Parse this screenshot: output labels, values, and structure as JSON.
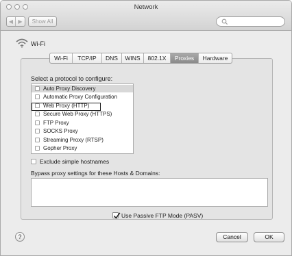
{
  "window": {
    "title": "Network"
  },
  "toolbar": {
    "back_glyph": "◀",
    "forward_glyph": "▶",
    "show_all_label": "Show All",
    "search_value": ""
  },
  "service": {
    "name": "Wi-Fi",
    "icon": "wifi-icon"
  },
  "tabs": [
    {
      "label": "Wi-Fi",
      "active": false
    },
    {
      "label": "TCP/IP",
      "active": false
    },
    {
      "label": "DNS",
      "active": false
    },
    {
      "label": "WINS",
      "active": false
    },
    {
      "label": "802.1X",
      "active": false
    },
    {
      "label": "Proxies",
      "active": true
    },
    {
      "label": "Hardware",
      "active": false
    }
  ],
  "proxies": {
    "protocol_prompt": "Select a protocol to configure:",
    "protocols": [
      {
        "label": "Auto Proxy Discovery",
        "checked": false,
        "selected": true
      },
      {
        "label": "Automatic Proxy Configuration",
        "checked": false,
        "selected": false
      },
      {
        "label": "Web Proxy (HTTP)",
        "checked": false,
        "selected": false,
        "highlighted": true
      },
      {
        "label": "Secure Web Proxy (HTTPS)",
        "checked": false,
        "selected": false
      },
      {
        "label": "FTP Proxy",
        "checked": false,
        "selected": false
      },
      {
        "label": "SOCKS Proxy",
        "checked": false,
        "selected": false
      },
      {
        "label": "Streaming Proxy (RTSP)",
        "checked": false,
        "selected": false
      },
      {
        "label": "Gopher Proxy",
        "checked": false,
        "selected": false
      }
    ],
    "exclude_simple_hostnames": {
      "label": "Exclude simple hostnames",
      "checked": false
    },
    "bypass_label": "Bypass proxy settings for these Hosts & Domains:",
    "bypass_value": "",
    "passive_ftp": {
      "label": "Use Passive FTP Mode (PASV)",
      "checked": true
    }
  },
  "footer": {
    "help_glyph": "?",
    "cancel_label": "Cancel",
    "ok_label": "OK"
  },
  "colors": {
    "active_tab": "#8f8f8f",
    "panel": "#e4e4e4",
    "window": "#ececec"
  }
}
